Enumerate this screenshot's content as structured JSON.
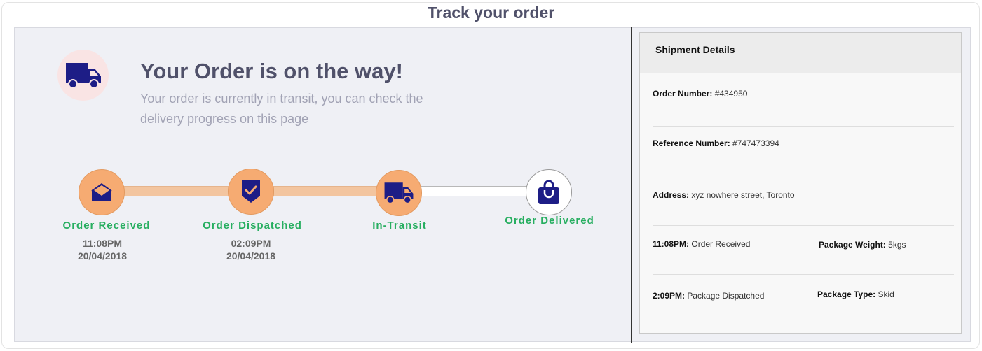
{
  "page": {
    "title": "Track your order"
  },
  "hero": {
    "icon": "truck-icon",
    "title": "Your Order is on the way!",
    "subtitle": "Your order is currently in transit, you can check the delivery progress on this page"
  },
  "progress": {
    "steps": [
      {
        "icon": "envelope-icon",
        "label": "Order Received",
        "time": "11:08PM",
        "date": "20/04/2018",
        "status": "done"
      },
      {
        "icon": "shield-check-icon",
        "label": "Order Dispatched",
        "time": "02:09PM",
        "date": "20/04/2018",
        "status": "done"
      },
      {
        "icon": "truck-icon",
        "label": "In-Transit",
        "time": "",
        "date": "",
        "status": "done"
      },
      {
        "icon": "shopping-bag-icon",
        "label": "Order Delivered",
        "time": "",
        "date": "",
        "status": "pending"
      }
    ]
  },
  "shipment": {
    "header": "Shipment Details",
    "order_number_label": "Order Number:",
    "order_number": "#434950",
    "reference_label": "Reference Number:",
    "reference": "#747473394",
    "address_label": "Address:",
    "address": "xyz nowhere street, Toronto",
    "event1_time": "11:08PM:",
    "event1_text": "Order Received",
    "weight_label": "Package Weight:",
    "weight": "5kgs",
    "event2_time": "2:09PM:",
    "event2_text": "Package Dispatched",
    "type_label": "Package Type:",
    "type": "Skid"
  },
  "colors": {
    "accent_orange": "#f6ab72",
    "icon_navy": "#1d1d86",
    "success_green": "#27ae60",
    "title_slate": "#50516a"
  }
}
